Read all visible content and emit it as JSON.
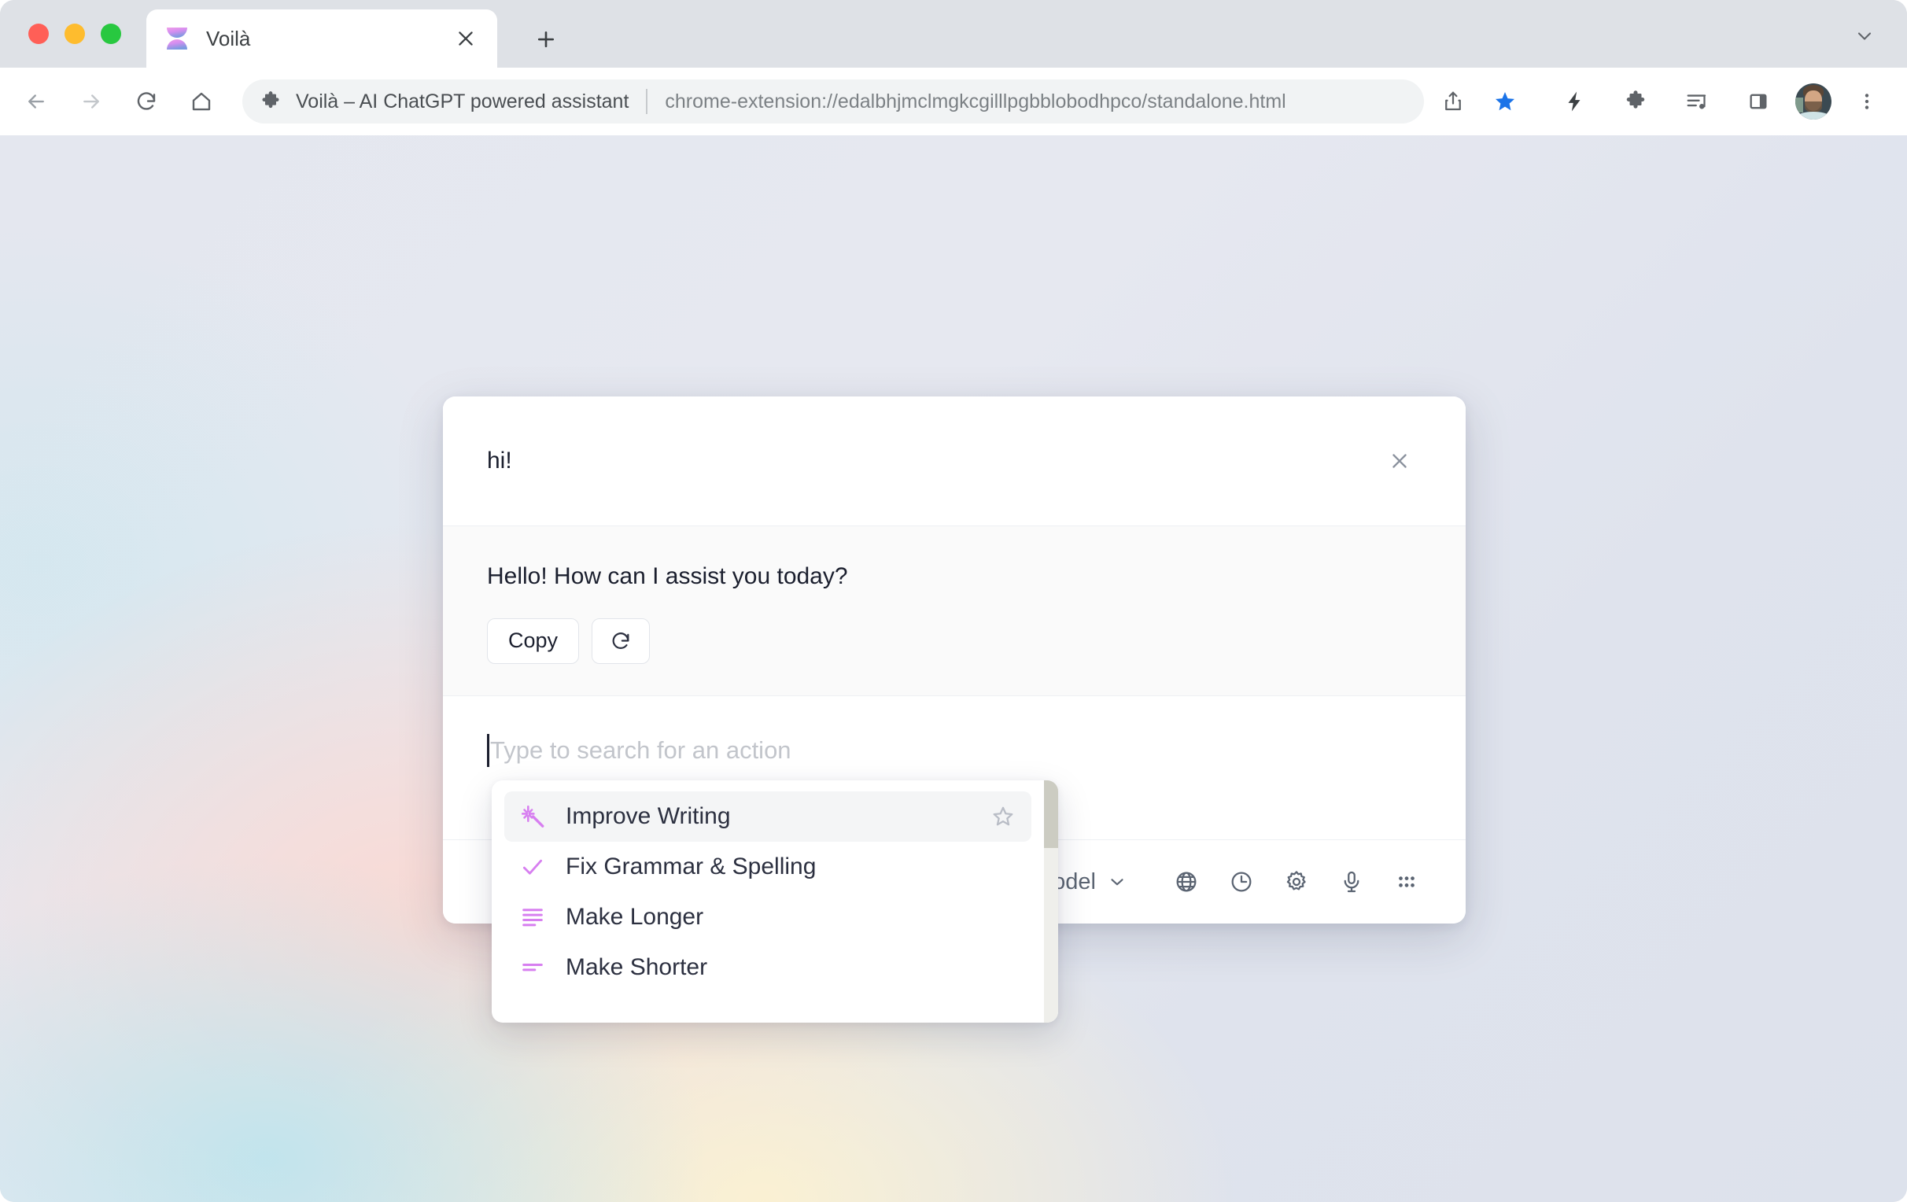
{
  "browser": {
    "tab": {
      "title": "Voilà",
      "favicon": "hourglass-icon",
      "close_icon": "close-icon"
    },
    "new_tab_icon": "plus-icon",
    "window_chevron_icon": "chevron-down-icon",
    "nav": {
      "back_icon": "arrow-left-icon",
      "forward_icon": "arrow-right-icon",
      "reload_icon": "reload-icon",
      "home_icon": "home-icon"
    },
    "omnibox": {
      "extension_icon": "puzzle-piece-icon",
      "extension_name": "Voilà – AI ChatGPT powered assistant",
      "url": "chrome-extension://edalbhjmclmgkcgilllpgbblobodhpco/standalone.html"
    },
    "toolbar_icons": [
      {
        "name": "share-icon",
        "label": "Share"
      },
      {
        "name": "bookmark-star-icon",
        "label": "Bookmark",
        "color": "#1a73e8",
        "active": true
      },
      {
        "name": "lightning-bolt-icon",
        "label": "Lightning"
      },
      {
        "name": "extensions-puzzle-icon",
        "label": "Extensions"
      },
      {
        "name": "media-playlist-icon",
        "label": "Media"
      },
      {
        "name": "side-panel-icon",
        "label": "Side panel"
      },
      {
        "name": "profile-avatar",
        "label": "Profile"
      },
      {
        "name": "kebab-menu-icon",
        "label": "Customize and control"
      }
    ]
  },
  "modal": {
    "title": "hi!",
    "close_icon": "close-icon",
    "response": {
      "text": "Hello! How can I assist you today?",
      "copy_label": "Copy",
      "regenerate_icon": "refresh-icon"
    },
    "search": {
      "placeholder": "Type to search for an action",
      "value": ""
    },
    "footer": {
      "model_label": "Model",
      "model_chevron_icon": "chevron-down-icon",
      "icons": [
        {
          "name": "globe-icon",
          "label": "Language"
        },
        {
          "name": "clock-history-icon",
          "label": "History"
        },
        {
          "name": "gear-settings-icon",
          "label": "Settings"
        },
        {
          "name": "microphone-icon",
          "label": "Voice"
        },
        {
          "name": "grid-dots-icon",
          "label": "More"
        }
      ]
    }
  },
  "dropdown": {
    "items": [
      {
        "label": "Improve Writing",
        "icon": "magic-wand-icon",
        "selected": true,
        "star_icon": "star-outline-icon"
      },
      {
        "label": "Fix Grammar & Spelling",
        "icon": "check-icon",
        "selected": false
      },
      {
        "label": "Make Longer",
        "icon": "lines-long-icon",
        "selected": false
      },
      {
        "label": "Make Shorter",
        "icon": "lines-short-icon",
        "selected": false
      }
    ]
  },
  "colors": {
    "accent_purple": "#d77ff0",
    "bookmark_blue": "#1a73e8",
    "text_dark": "#1b1f2e",
    "text_muted": "#5b6472"
  }
}
